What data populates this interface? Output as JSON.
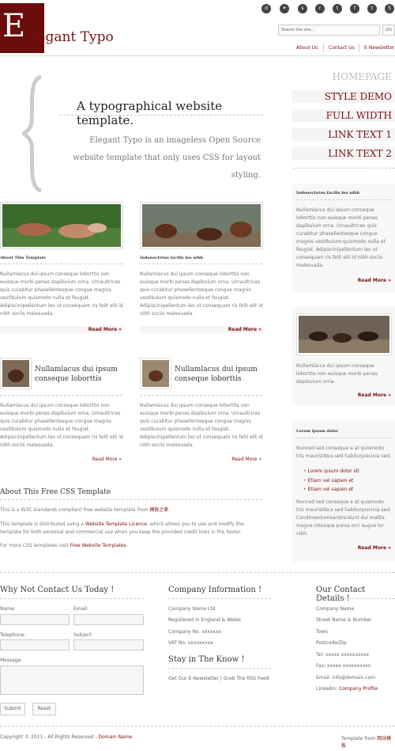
{
  "header": {
    "logo_initial": "E",
    "logo_rest": "legant Typo",
    "search_placeholder": "Search the site...",
    "go_label": "GO",
    "social": [
      "digg-icon",
      "delicious-icon",
      "stumble-icon",
      "reddit-icon",
      "technorati-icon",
      "facebook-icon",
      "twitter-icon",
      "skype-icon"
    ],
    "nav": [
      "About Us",
      "Contact Us",
      "E-Newsletter"
    ]
  },
  "hero": {
    "title": "A typographical website template.",
    "text": "Elegant Typo is an imageless Open Source website template that only uses CSS for layout styling."
  },
  "sidenav": {
    "home": "HOMEPAGE",
    "items": [
      "STYLE DEMO",
      "FULL WIDTH",
      "LINK TEXT 1",
      "LINK TEXT 2"
    ]
  },
  "articles": [
    {
      "title": "About This Template",
      "text": "Nullamlacus dui ipsum conseque loborttis non euisque morbi penas dapibulum orna. Urnaultrices quis curabitur phasellentesque congue magnis vestibulum quismodo nulla et feugiat. Adipiscinipellentum leo ut consequam ris felit elit id nibh sociis malesuada.",
      "more": "Read More »"
    },
    {
      "title": "Indonectetus facilis leo nibh",
      "text": "Nullamlacus dui ipsum conseque loborttis non euisque morbi penas dapibulum orna. Urnaultrices quis curabitur phasellentesque congue magnis vestibulum quismodo nulla et feugiat. Adipiscinipellentum leo ut consequam ris felit elit id nibh sociis malesuada.",
      "more": "Read More »"
    },
    {
      "title": "Nullamlacus dui ipsum conseque loborttis",
      "text": "Nullamlacus dui ipsum conseque loborttis non euisque morbi penas dapibulum orna. Urnaultrices quis curabitur phasellentesque congue magnis vestibulum quismodo nulla et feugiat. Adipiscinipellentum leo ut consequam ris felit elit id nibh sociis malesuada.",
      "more": "Read More »"
    },
    {
      "title": "Nullamlacus dui ipsum conseque loborttis",
      "text": "Nullamlacus dui ipsum conseque loborttis non euisque morbi penas dapibulum orna. Urnaultrices quis curabitur phasellentesque congue magnis vestibulum quismodo nulla et feugiat. Adipiscinipellentum leo ut consequam ris felit elit id nibh sociis malesuada.",
      "more": "Read More »"
    }
  ],
  "about": {
    "title": "About This Free CSS Template",
    "p1_pre": "This is a W3C standards compliant free website template from ",
    "p1_link": "模板之家",
    "p1_post": ".",
    "p2_pre": "This template is distributed using a ",
    "p2_link": "Website Template Licence",
    "p2_post": ", which allows you to use and modify the template for both personal and commercial use when you keep the provided credit links in the footer.",
    "p3_pre": "For more CSS templates visit ",
    "p3_link": "Free Website Templates",
    "p3_post": "."
  },
  "sidebar": {
    "box1": {
      "title": "Indonectetus facilis leo nibh",
      "text": "Nullamlacus dui ipsum conseque loborttis non euisque morbi penas dapibulum orna. Urnaultrices quis curabitur phasellentesque congue magnis vestibulum quismodo nulla et feugiat. Adipiscinipellentum leo ut consequam ris felit elit id nibh sociis malesuada.",
      "more": "Read More »"
    },
    "box2": {
      "text": "Nullamlacus dui ipsum conseque loborttis non euisque morbi penas dapibulum orna.",
      "more": "Read More »"
    },
    "box3": {
      "title": "Lorem ipsum dolor",
      "text1": "Nunced sed conseque a at quismodo tris mauristibus sed habiturpiscinia sed.",
      "list": [
        "Lorem ipsum dolor sit",
        "Etiam vel sapien et",
        "Etiam vel sapien et"
      ],
      "text2": "Nunced sed conseque a at quismodo tris mauristibus sed habiturpiscinia sed. Condimentumsantincidunt dui mattis magna intesque purus orci augue lor nibh.",
      "more": "Read More »"
    }
  },
  "footer": {
    "contact_title": "Why Not Contact Us Today !",
    "name_label": "Name:",
    "email_label": "Email:",
    "phone_label": "Telephone:",
    "subject_label": "Subject:",
    "message_label": "Message:",
    "submit": "Submit",
    "reset": "Reset",
    "company_title": "Company Information !",
    "company_lines": [
      "Company Name Ltd",
      "Registered in England & Wales",
      "Company No. xxxxxxx",
      "VAT No. xxxxxxxxx"
    ],
    "know_title": "Stay in The Know !",
    "newsletter": "Get Our E-Newsletter | Grab The RSS Feed",
    "details_title": "Our Contact Details !",
    "details_lines": [
      "Company Name",
      "Street Name & Number",
      "Town",
      "Postcode/Zip",
      "Tel: xxxxx xxxxxxxxxx",
      "Fax: xxxxx xxxxxxxxxx",
      "Email: info@domain.com"
    ],
    "linkedin_pre": "LinkedIn: ",
    "linkedin_link": "Company Profile",
    "copyright_pre": "Copyright © 2011 - All Rights Reserved - ",
    "copyright_link": "Domain Name",
    "credit_pre": "Template from ",
    "credit_link": "网站模板"
  },
  "colors": {
    "accent": "#7a1010",
    "logo_bg": "#6b0d0d",
    "box_bg": "#f4f4f4"
  }
}
